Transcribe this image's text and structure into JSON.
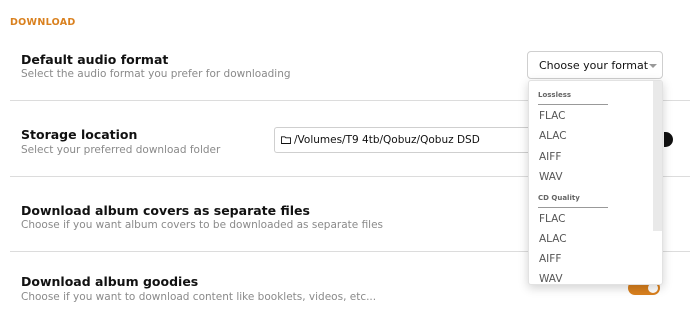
{
  "colors": {
    "accent": "#d9801e",
    "section_header": "#d9801e"
  },
  "section": {
    "title": "DOWNLOAD"
  },
  "settings": {
    "audio_format": {
      "title": "Default audio format",
      "description": "Select the audio format you prefer for downloading",
      "select_value": "Choose your format"
    },
    "storage": {
      "title": "Storage location",
      "description": "Select your preferred download folder",
      "path": "/Volumes/T9 4tb/Qobuz/Qobuz DSD"
    },
    "album_covers": {
      "title": "Download album covers as separate files",
      "description": "Choose if you want album covers to be downloaded as separate files"
    },
    "goodies": {
      "title": "Download album goodies",
      "description": "Choose if you want to download content like booklets, videos, etc...",
      "toggle_on": true
    }
  },
  "dropdown": {
    "groups": [
      {
        "label": "Lossless",
        "options": [
          "FLAC",
          "ALAC",
          "AIFF",
          "WAV"
        ]
      },
      {
        "label": "CD Quality",
        "options": [
          "FLAC",
          "ALAC",
          "AIFF",
          "WAV"
        ]
      }
    ]
  },
  "icons": {
    "folder": "folder-icon",
    "caret": "chevron-down-icon"
  }
}
